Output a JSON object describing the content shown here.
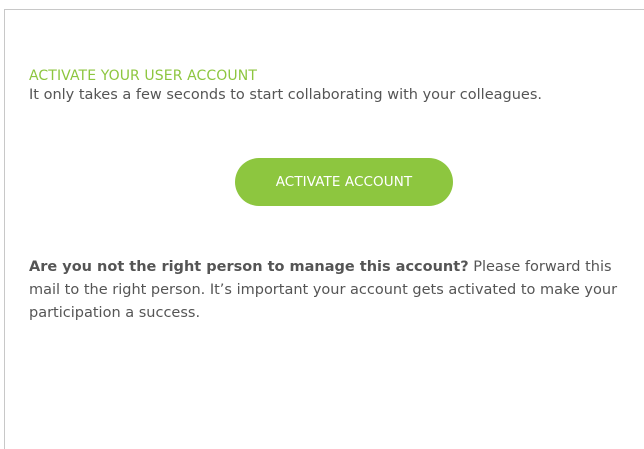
{
  "email": {
    "heading": "ACTIVATE YOUR USER ACCOUNT",
    "subtitle": "It only takes a few seconds to start collaborating with your colleagues.",
    "cta_label": "ACTIVATE ACCOUNT",
    "question": "Are you not the right person to manage this account?",
    "body": " Please forward this mail to the right person. It’s important your account gets activated to make your participation a success."
  },
  "colors": {
    "accent": "#8dc63f",
    "text": "#555555",
    "border": "#c8c8c8",
    "background": "#ffffff"
  }
}
